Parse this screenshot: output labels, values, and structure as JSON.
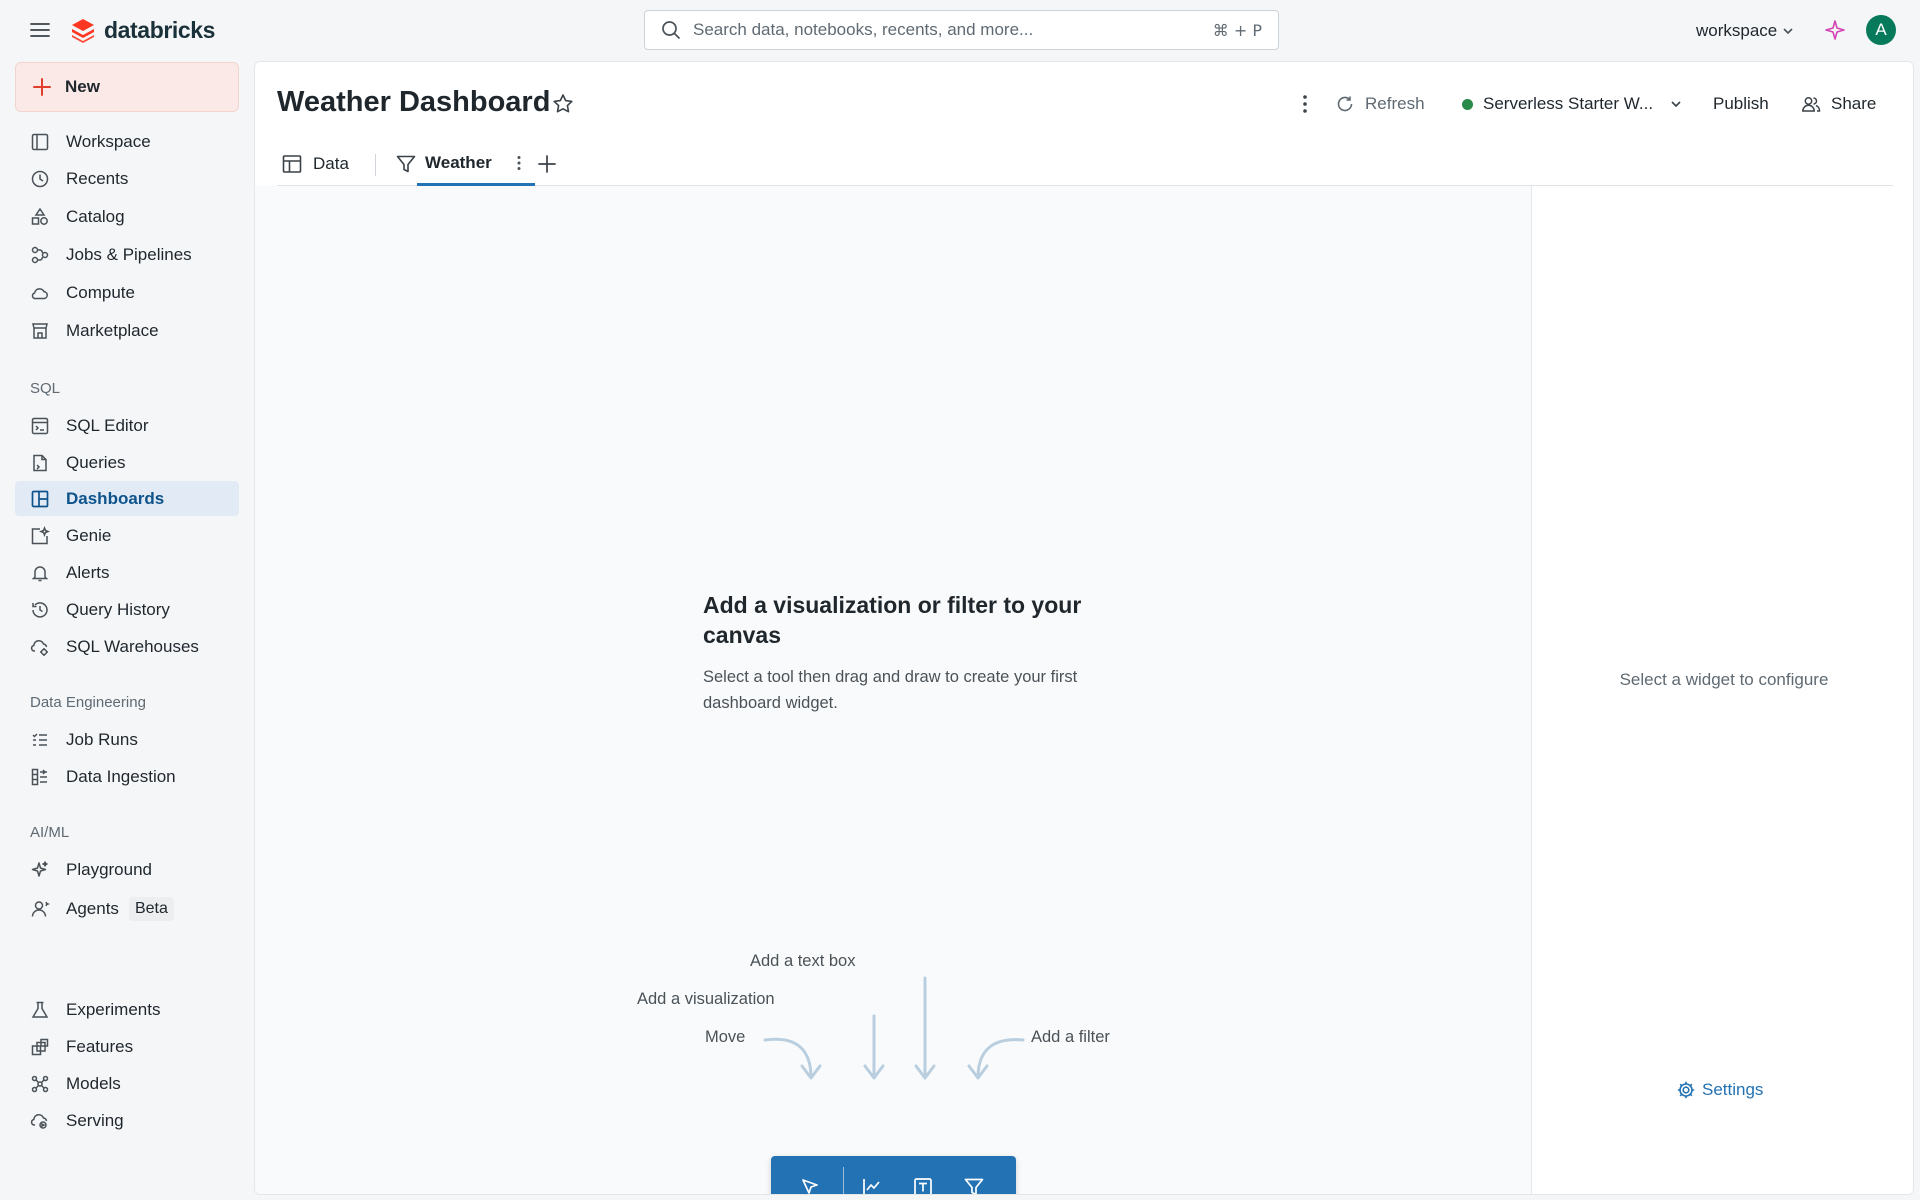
{
  "brand": {
    "name": "databricks",
    "accent": "#e0402b"
  },
  "search": {
    "placeholder": "Search data, notebooks, recents, and more...",
    "shortcut": "⌘ + P"
  },
  "workspace_switcher": {
    "label": "workspace"
  },
  "user": {
    "initial": "A",
    "avatar_color": "#077a5b"
  },
  "sidebar": {
    "new_label": "New",
    "items": [
      {
        "label": "Workspace",
        "icon": "workspace-icon"
      },
      {
        "label": "Recents",
        "icon": "clock-icon"
      },
      {
        "label": "Catalog",
        "icon": "catalog-icon"
      },
      {
        "label": "Jobs & Pipelines",
        "icon": "workflow-icon"
      },
      {
        "label": "Compute",
        "icon": "cloud-icon"
      },
      {
        "label": "Marketplace",
        "icon": "store-icon"
      }
    ],
    "sections": [
      {
        "label": "SQL",
        "items": [
          {
            "label": "SQL Editor",
            "icon": "sql-editor-icon"
          },
          {
            "label": "Queries",
            "icon": "query-file-icon"
          },
          {
            "label": "Dashboards",
            "icon": "dashboard-icon",
            "active": true
          },
          {
            "label": "Genie",
            "icon": "genie-icon"
          },
          {
            "label": "Alerts",
            "icon": "bell-icon"
          },
          {
            "label": "Query History",
            "icon": "history-icon"
          },
          {
            "label": "SQL Warehouses",
            "icon": "warehouse-icon"
          }
        ]
      },
      {
        "label": "Data Engineering",
        "items": [
          {
            "label": "Job Runs",
            "icon": "list-check-icon"
          },
          {
            "label": "Data Ingestion",
            "icon": "ingestion-icon"
          }
        ]
      },
      {
        "label": "AI/ML",
        "items": [
          {
            "label": "Playground",
            "icon": "sparkle-icon"
          },
          {
            "label": "Agents",
            "icon": "agent-icon",
            "badge": "Beta"
          },
          {
            "label": "Experiments",
            "icon": "flask-icon"
          },
          {
            "label": "Features",
            "icon": "features-icon"
          },
          {
            "label": "Models",
            "icon": "models-icon"
          },
          {
            "label": "Serving",
            "icon": "serving-icon"
          }
        ]
      }
    ]
  },
  "dashboard": {
    "title": "Weather Dashboard",
    "header": {
      "refresh_label": "Refresh",
      "warehouse_label": "Serverless Starter W...",
      "warehouse_status_color": "#2a8a4a",
      "publish_label": "Publish",
      "share_label": "Share"
    },
    "tabs": {
      "data_label": "Data",
      "page_label": "Weather"
    },
    "canvas": {
      "empty_title": "Add a visualization or filter to your canvas",
      "empty_description": "Select a tool then drag and draw to create your first dashboard widget.",
      "hints": {
        "move": "Move",
        "visualization": "Add a visualization",
        "text_box": "Add a text box",
        "filter": "Add a filter"
      }
    },
    "right_panel": {
      "message": "Select a widget to configure",
      "settings_label": "Settings"
    }
  }
}
